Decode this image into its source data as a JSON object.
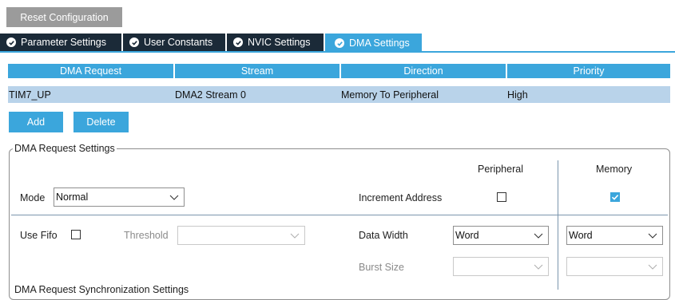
{
  "toolbar": {
    "reset_label": "Reset Configuration"
  },
  "tabs": [
    {
      "label": "Parameter Settings",
      "icon": "check-circle-icon"
    },
    {
      "label": "User Constants",
      "icon": "check-circle-icon"
    },
    {
      "label": "NVIC Settings",
      "icon": "check-circle-icon"
    },
    {
      "label": "DMA Settings",
      "icon": "check-circle-icon",
      "active": true
    }
  ],
  "dma_table": {
    "columns": [
      "DMA Request",
      "Stream",
      "Direction",
      "Priority"
    ],
    "rows": [
      [
        "TIM7_UP",
        "DMA2 Stream 0",
        "Memory To Peripheral",
        "High"
      ]
    ]
  },
  "actions": {
    "add_label": "Add",
    "delete_label": "Delete"
  },
  "request_settings": {
    "title": "DMA Request Settings",
    "peripheral_header": "Peripheral",
    "memory_header": "Memory",
    "mode_label": "Mode",
    "mode_value": "Normal",
    "increment_label": "Increment Address",
    "increment_peripheral": false,
    "increment_memory": true,
    "use_fifo_label": "Use Fifo",
    "use_fifo": false,
    "threshold_label": "Threshold",
    "threshold_value": "",
    "data_width_label": "Data Width",
    "data_width_peripheral": "Word",
    "data_width_memory": "Word",
    "burst_size_label": "Burst Size",
    "burst_peripheral": "",
    "burst_memory": ""
  },
  "sync_settings": {
    "title": "DMA Request Synchronization Settings"
  },
  "colors": {
    "accent": "#3ba6dc",
    "tab_dark": "#1b2a38",
    "row_selected": "#b9d3ea",
    "button_grey": "#9b9b9b"
  }
}
